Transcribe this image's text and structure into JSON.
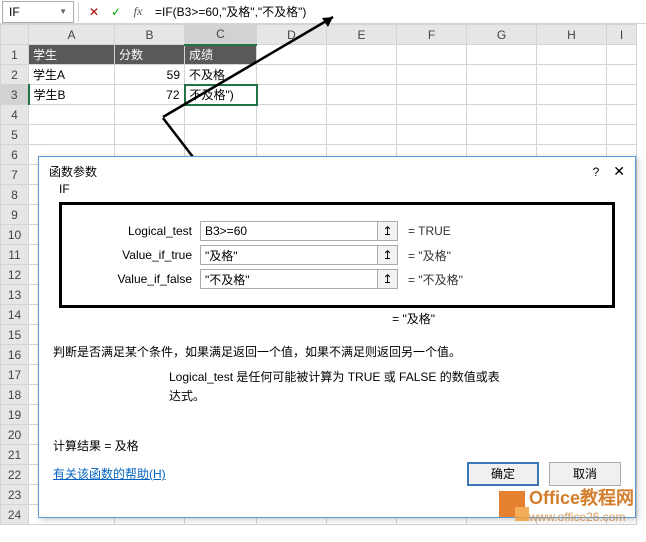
{
  "nameBox": "IF",
  "formula": "=IF(B3>=60,\"及格\",\"不及格\")",
  "columns": [
    "A",
    "B",
    "C",
    "D",
    "E",
    "F",
    "G",
    "H",
    "I"
  ],
  "rows": [
    "1",
    "2",
    "3",
    "4",
    "5",
    "6",
    "7",
    "8",
    "9",
    "10",
    "11",
    "12",
    "13",
    "14",
    "15",
    "16",
    "17",
    "18",
    "19",
    "20",
    "21",
    "22",
    "23",
    "24"
  ],
  "table": {
    "h1": "学生",
    "h2": "分数",
    "h3": "成绩",
    "r2a": "学生A",
    "r2b": "59",
    "r2c": "不及格",
    "r3a": "学生B",
    "r3b": "72",
    "r3c": "不及格\")"
  },
  "dialog": {
    "title": "函数参数",
    "help": "?",
    "funcName": "IF",
    "args": {
      "logical_test": {
        "label": "Logical_test",
        "value": "B3>=60",
        "eval": "=   TRUE"
      },
      "value_if_true": {
        "label": "Value_if_true",
        "value": "\"及格\"",
        "eval": "=   \"及格\""
      },
      "value_if_false": {
        "label": "Value_if_false",
        "value": "\"不及格\"",
        "eval": "=   \"不及格\""
      }
    },
    "overallEval": "=  \"及格\"",
    "desc1": "判断是否满足某个条件，如果满足返回一个值，如果不满足则返回另一个值。",
    "desc2": "Logical_test    是任何可能被计算为 TRUE 或 FALSE 的数值或表达式。",
    "resultLabel": "计算结果 =   及格",
    "helpLink": "有关该函数的帮助(H)",
    "ok": "确定",
    "cancel": "取消"
  },
  "watermark": {
    "t1": "Office教程网",
    "t2": "www.office26.com"
  }
}
